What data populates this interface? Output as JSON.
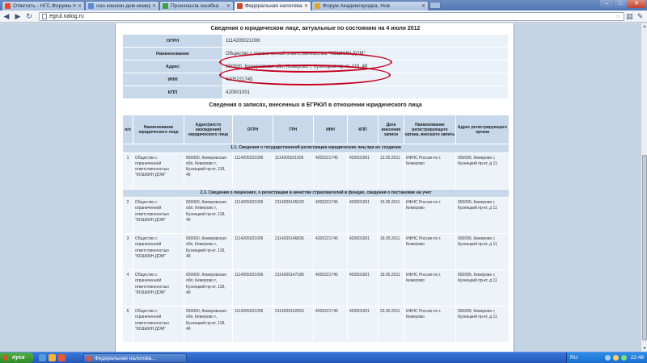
{
  "browser": {
    "tabs": [
      {
        "title": "Ответить - НГС.Форумы Н",
        "color": "#e74c2a"
      },
      {
        "title": "ооо кошкин дом кемерово",
        "color": "#5a8ad6"
      },
      {
        "title": "Произошла ошибка",
        "color": "#3fa04b"
      },
      {
        "title": "Федеральная налоговая сл",
        "color": "#c94b2c"
      },
      {
        "title": "Форум Академгородка, Нов",
        "color": "#e0a72a"
      }
    ],
    "url": "egrul.nalog.ru"
  },
  "page": {
    "title": "Сведения о юридическом лице, актуальные по состоянию на 4 июля 2012",
    "info": [
      {
        "key": "ОГРН",
        "value": "1114205021006"
      },
      {
        "key": "Наименование",
        "value": "Общество с ограниченной ответственностью \"КОШКИН ДОМ\""
      },
      {
        "key": "Адрес",
        "value": "650000, Кемеровская обл, Кемерово г, Кузнецкий пр-кт, 118, 49"
      },
      {
        "key": "ИНН",
        "value": "4205221745"
      },
      {
        "key": "КПП",
        "value": "420501001"
      }
    ],
    "records_title": "Сведения о записях, внесенных в ЕГРЮЛ в отношении юридического лица",
    "columns": [
      "п/п",
      "Наименование юридического лица",
      "Адрес(место нахождения) юридического лица",
      "ОГРН",
      "ГРН",
      "ИНН",
      "КПП",
      "Дата внесения записи",
      "Наименование регистрирующего органа, внесшего запись",
      "Адрес регистрирующего органа"
    ],
    "sections": [
      {
        "title": "1.1. Сведения о государственной регистрации юридических лиц при их создании",
        "rows": [
          [
            "1",
            "Общество с ограниченной ответственностью \"КОШКИН ДОМ\"",
            "650000, Кемеровская обл, Кемерово г, Кузнецкий пр-кт, 118, 49",
            "1114205021006",
            "1114205021006",
            "4205221745",
            "420501001",
            "13.05.2011",
            "ИФНС России по г. Кемерово",
            "650099, Кемерово г, Кузнецкий пр-кт, д 11"
          ]
        ]
      },
      {
        "title": "2.3. Сведения о лицензиях, о регистрации в качестве страхователей в фондах, сведения о постановке на учет",
        "rows": [
          [
            "2",
            "Общество с ограниченной ответственностью \"КОШКИН ДОМ\"",
            "650000, Кемеровская обл, Кемерово г, Кузнецкий пр-кт, 118, 49",
            "1114205021006",
            "2114205145020",
            "4205221745",
            "420501001",
            "16.05.2011",
            "ИФНС России по г. Кемерово",
            "650099, Кемерово г, Кузнецкий пр-кт, д 11"
          ],
          [
            "3",
            "Общество с ограниченной ответственностью \"КОШКИН ДОМ\"",
            "650000, Кемеровская обл, Кемерово г, Кузнецкий пр-кт, 118, 49",
            "1114205021006",
            "2114205146836",
            "4205221745",
            "420501001",
            "18.05.2011",
            "ИФНС России по г. Кемерово",
            "650099, Кемерово г, Кузнецкий пр-кт, д 11"
          ],
          [
            "4",
            "Общество с ограниченной ответственностью \"КОШКИН ДОМ\"",
            "650000, Кемеровская обл, Кемерово г, Кузнецкий пр-кт, 118, 49",
            "1114205021006",
            "2114205147186",
            "4205221745",
            "420501001",
            "18.05.2011",
            "ИФНС России по г. Кемерово",
            "650099, Кемерово г, Кузнецкий пр-кт, д 11"
          ],
          [
            "5",
            "Общество с ограниченной ответственностью \"КОШКИН ДОМ\"",
            "650000, Кемеровская обл, Кемерово г, Кузнецкий пр-кт, 118, 49",
            "1114205021006",
            "2114205152653",
            "4205221745",
            "420501001",
            "23.05.2011",
            "ИФНС России по г. Кемерово",
            "650099, Кемерово г, Кузнецкий пр-кт, д 11"
          ]
        ]
      }
    ]
  },
  "taskbar": {
    "start_label": "пуск",
    "task_title": "Федеральная налогова...",
    "lang": "RU",
    "clock": "22:46"
  },
  "icons": {
    "back": "back-arrow-icon",
    "forward": "forward-arrow-icon",
    "reload": "reload-icon",
    "home": "home-icon",
    "star": "bookmark-star-icon",
    "page": "page-icon",
    "wrench": "wrench-icon"
  },
  "colors": {
    "header_cell": "#c6d8ea",
    "row_cell": "#eef3f9",
    "annotation": "#c4001f",
    "taskbar": "#2457b8"
  }
}
